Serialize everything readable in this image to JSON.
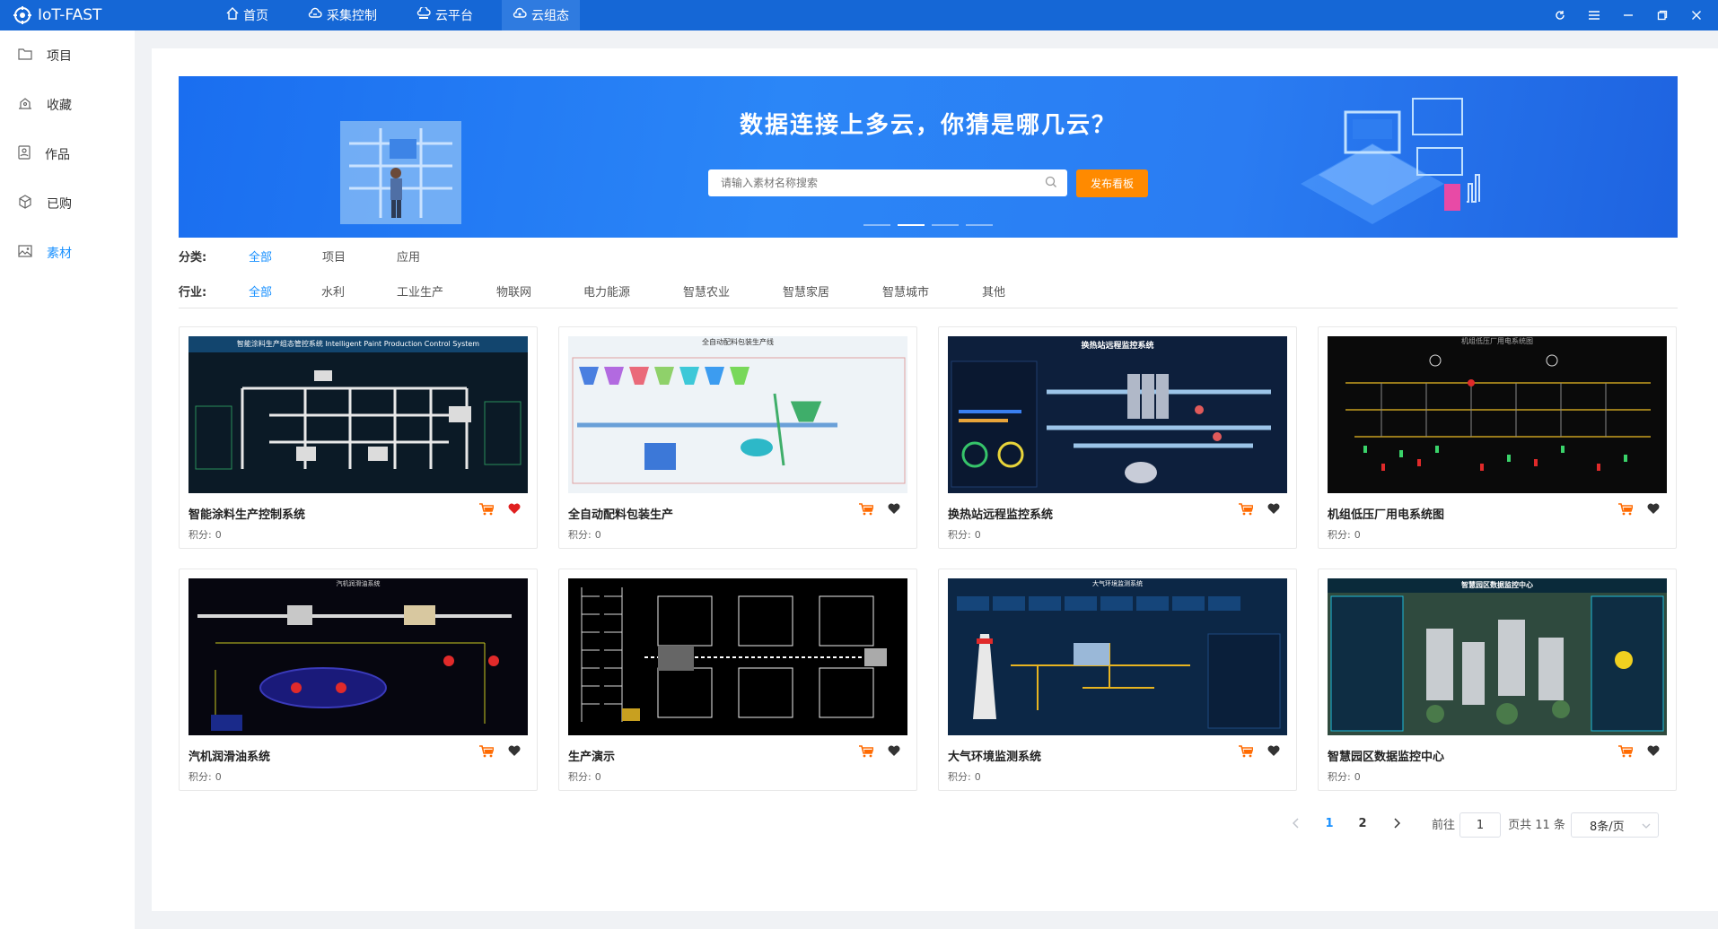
{
  "app": {
    "title": "IoT-FAST"
  },
  "nav": [
    {
      "label": "首页",
      "icon": "home-icon"
    },
    {
      "label": "采集控制",
      "icon": "cloud-control-icon"
    },
    {
      "label": "云平台",
      "icon": "cloud-platform-icon"
    },
    {
      "label": "云组态",
      "icon": "cloud-config-icon",
      "active": true
    }
  ],
  "window_controls": [
    "refresh-icon",
    "menu-icon",
    "minimize-icon",
    "maximize-icon",
    "close-icon"
  ],
  "sidebar": {
    "items": [
      {
        "label": "项目",
        "icon": "folder-icon"
      },
      {
        "label": "收藏",
        "icon": "favorites-icon"
      },
      {
        "label": "作品",
        "icon": "works-icon"
      },
      {
        "label": "已购",
        "icon": "purchased-icon"
      },
      {
        "label": "素材",
        "icon": "material-icon",
        "active": true
      }
    ]
  },
  "banner": {
    "title": "数据连接上多云，你猜是哪几云？",
    "search_placeholder": "请输入素材名称搜索",
    "publish_button": "发布看板",
    "slide_count": 4,
    "active_slide": 2
  },
  "filters": {
    "category": {
      "label": "分类:",
      "options": [
        "全部",
        "项目",
        "应用"
      ],
      "active": 0
    },
    "industry": {
      "label": "行业:",
      "options": [
        "全部",
        "水利",
        "工业生产",
        "物联网",
        "电力能源",
        "智慧农业",
        "智慧家居",
        "智慧城市",
        "其他"
      ],
      "active": 0
    }
  },
  "cards": [
    {
      "title": "智能涂料生产控制系统",
      "points_label": "积分:",
      "points": "0",
      "favorited": true,
      "thumb_caption": "智能涂料生产组态管控系统 Intelligent Paint Production Control System",
      "thumb_theme": "#0b1a26"
    },
    {
      "title": "全自动配料包装生产",
      "points_label": "积分:",
      "points": "0",
      "favorited": false,
      "thumb_caption": "全自动配料包装生产线",
      "thumb_theme": "#eef3f7"
    },
    {
      "title": "换热站远程监控系统",
      "points_label": "积分:",
      "points": "0",
      "favorited": false,
      "thumb_caption": "换热站远程监控系统",
      "thumb_theme": "#0d1f3c"
    },
    {
      "title": "机组低压厂用电系统图",
      "points_label": "积分:",
      "points": "0",
      "favorited": false,
      "thumb_caption": "机组低压厂用电系统图",
      "thumb_theme": "#0a0a0a"
    },
    {
      "title": "汽机润滑油系统",
      "points_label": "积分:",
      "points": "0",
      "favorited": false,
      "thumb_caption": "汽机润滑油系统",
      "thumb_theme": "#06060f"
    },
    {
      "title": "生产演示",
      "points_label": "积分:",
      "points": "0",
      "favorited": false,
      "thumb_caption": "",
      "thumb_theme": "#000000"
    },
    {
      "title": "大气环境监测系统",
      "points_label": "积分:",
      "points": "0",
      "favorited": false,
      "thumb_caption": "大气环境监测系统",
      "thumb_theme": "#0c2746"
    },
    {
      "title": "智慧园区数据监控中心",
      "points_label": "积分:",
      "points": "0",
      "favorited": false,
      "thumb_caption": "智慧园区数据监控中心",
      "thumb_theme": "#0a2a3a"
    }
  ],
  "pagination": {
    "pages": [
      "1",
      "2"
    ],
    "current": "1",
    "goto_label": "前往",
    "goto_value": "1",
    "total_text": "页共 11 条",
    "page_size": "8条/页"
  },
  "colors": {
    "topbar": "#1567d6",
    "accent": "#1890ff",
    "publish_button": "#ff8a00",
    "cart": "#ff6a00",
    "heart_active": "#e02020",
    "heart_inactive": "#333333"
  }
}
